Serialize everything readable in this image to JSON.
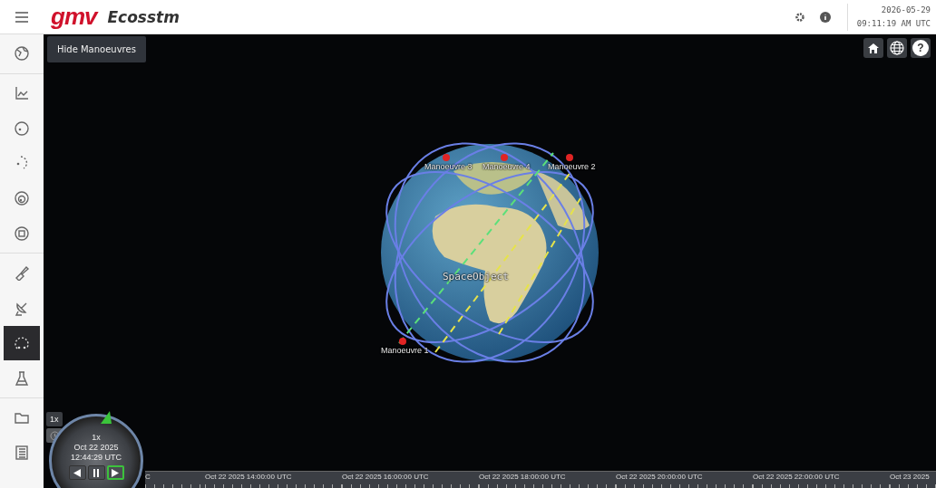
{
  "header": {
    "logo": "gmv",
    "app_name": "Ecosstm",
    "date": "2026-05-29",
    "time": "09:11:19 AM UTC"
  },
  "sidebar": {
    "groups": [
      [
        {
          "kind": "globe",
          "selected": false
        }
      ],
      [
        {
          "kind": "chart",
          "selected": false
        },
        {
          "kind": "orbit",
          "selected": false
        },
        {
          "kind": "arc",
          "selected": false
        },
        {
          "kind": "spiral",
          "selected": false
        },
        {
          "kind": "calendar",
          "selected": false
        }
      ],
      [
        {
          "kind": "satellite",
          "selected": false
        },
        {
          "kind": "dish",
          "selected": false
        },
        {
          "kind": "gauge",
          "selected": true
        },
        {
          "kind": "flask",
          "selected": false
        }
      ],
      [
        {
          "kind": "folder",
          "selected": false
        },
        {
          "kind": "list",
          "selected": false
        }
      ]
    ]
  },
  "viewer": {
    "hide_button": "Hide Manoeuvres",
    "help_label": "?",
    "labels": [
      {
        "kind": "manoeuvre",
        "text": "Manoeuvre 3"
      },
      {
        "kind": "manoeuvre",
        "text": "Manoeuvre 4"
      },
      {
        "kind": "manoeuvre",
        "text": "Manoeuvre 2"
      },
      {
        "kind": "object",
        "text": "SpaceObject"
      },
      {
        "kind": "manoeuvre",
        "text": "Manoeuvre 1"
      }
    ]
  },
  "animation": {
    "speed_button": "1x",
    "speed": "1x",
    "date": "Oct 22 2025",
    "time": "12:44:29 UTC",
    "controls": [
      {
        "kind": "reverse",
        "selected": false
      },
      {
        "kind": "pause",
        "selected": false
      },
      {
        "kind": "play",
        "selected": true
      }
    ]
  },
  "timeline": {
    "labels": [
      "C",
      "Oct 22 2025 14:00:00 UTC",
      "Oct 22 2025 16:00:00 UTC",
      "Oct 22 2025 18:00:00 UTC",
      "Oct 22 2025 20:00:00 UTC",
      "Oct 22 2025 22:00:00 UTC",
      "Oct 23 2025"
    ]
  }
}
